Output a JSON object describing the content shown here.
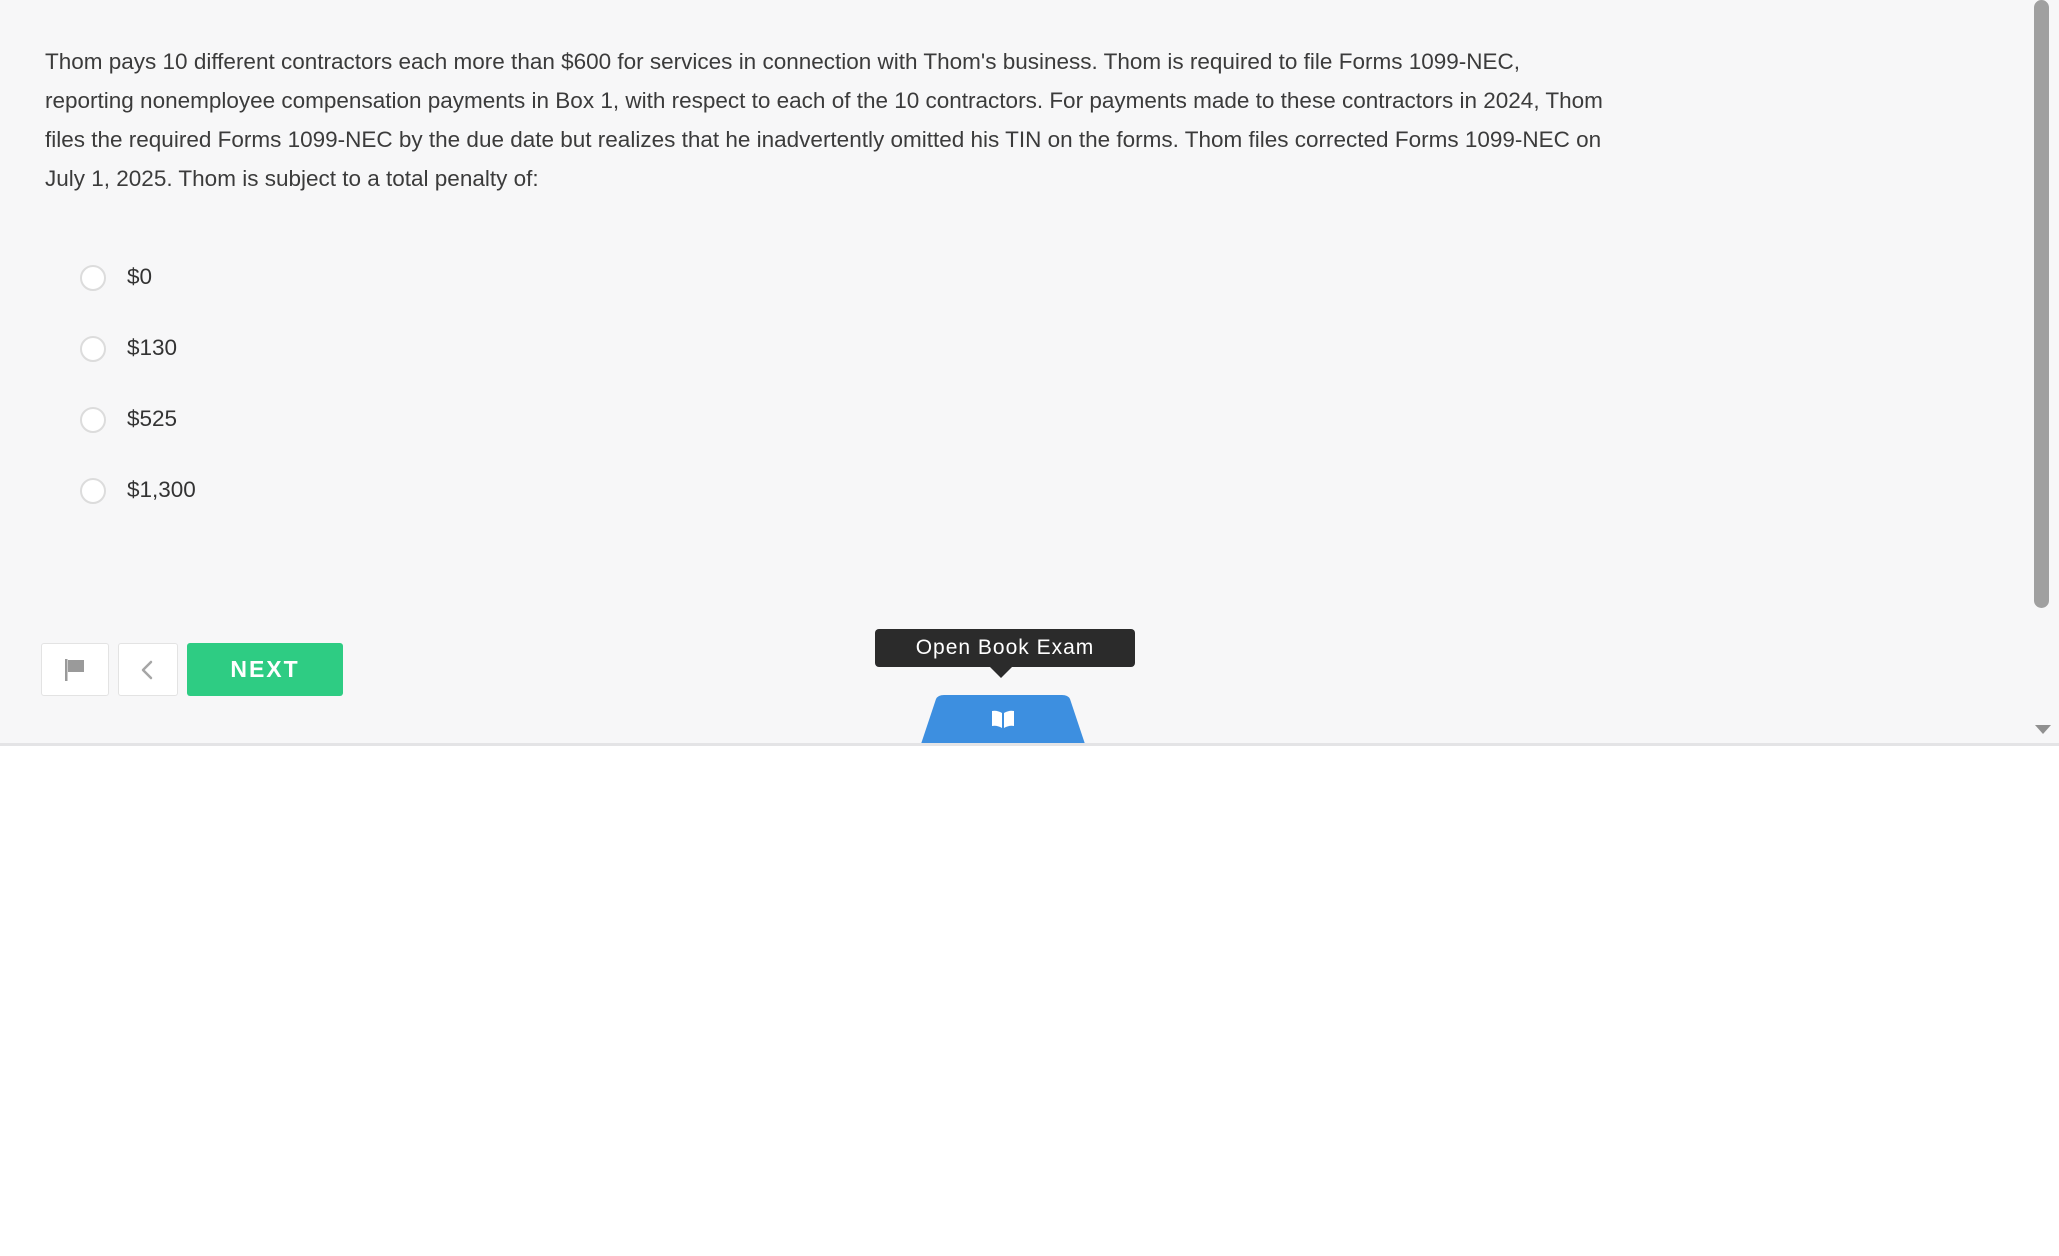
{
  "question": {
    "text": "Thom pays 10 different contractors each more than $600 for services in connection with Thom's business. Thom is required to file Forms 1099-NEC, reporting nonemployee compensation payments in Box 1, with respect to each of the 10 contractors. For payments made to these contractors in 2024, Thom files the required Forms 1099-NEC by the due date but realizes that he inadvertently omitted his TIN on the forms. Thom files corrected Forms 1099-NEC on July 1, 2025. Thom is subject to a total penalty of:"
  },
  "choices": [
    {
      "label": "$0",
      "selected": false
    },
    {
      "label": "$130",
      "selected": false
    },
    {
      "label": "$525",
      "selected": false
    },
    {
      "label": "$1,300",
      "selected": false
    }
  ],
  "toolbar": {
    "flag_icon": "flag-icon",
    "back_icon": "chevron-left-icon",
    "next_label": "NEXT"
  },
  "open_book": {
    "tooltip": "Open Book Exam",
    "icon": "open-book-icon"
  },
  "colors": {
    "accent_green": "#2ecc83",
    "tab_blue": "#3d8fe0",
    "tooltip_bg": "#2b2b2b",
    "panel_bg": "#f7f7f8"
  }
}
